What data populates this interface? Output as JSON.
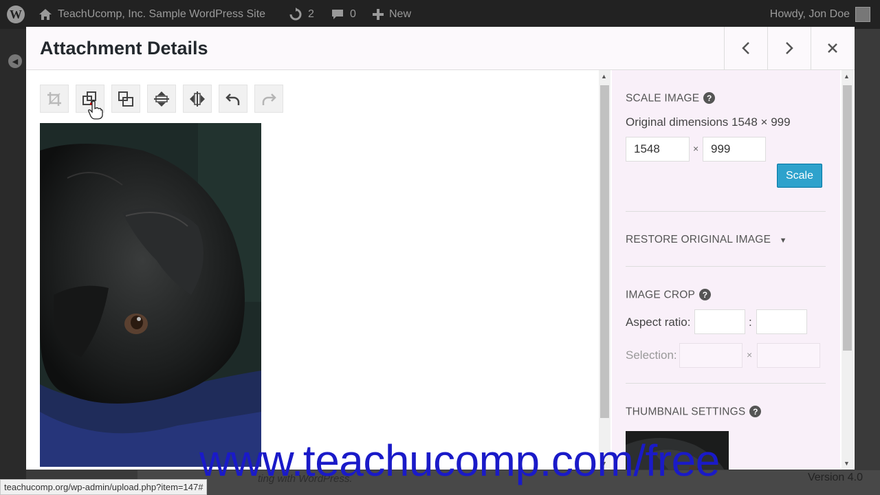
{
  "adminbar": {
    "site_name": "TeachUcomp, Inc. Sample WordPress Site",
    "updates_count": "2",
    "comments_count": "0",
    "new_label": "New",
    "howdy": "Howdy, Jon Doe"
  },
  "modal": {
    "title": "Attachment Details"
  },
  "editor": {
    "tools": [
      {
        "name": "crop",
        "enabled": false
      },
      {
        "name": "rotate-left",
        "enabled": true
      },
      {
        "name": "rotate-right",
        "enabled": true
      },
      {
        "name": "flip-vertical",
        "enabled": true
      },
      {
        "name": "flip-horizontal",
        "enabled": true
      },
      {
        "name": "undo",
        "enabled": true
      },
      {
        "name": "redo",
        "enabled": false
      }
    ]
  },
  "sidebar": {
    "scale": {
      "title": "SCALE IMAGE",
      "original_dimensions": "Original dimensions 1548 × 999",
      "width": "1548",
      "times": "×",
      "height": "999",
      "button": "Scale"
    },
    "restore": {
      "title": "RESTORE ORIGINAL IMAGE"
    },
    "crop": {
      "title": "IMAGE CROP",
      "aspect_label": "Aspect ratio:",
      "aspect_sep": ":",
      "selection_label": "Selection:",
      "selection_sep": "×"
    },
    "thumbnail": {
      "title": "THUMBNAIL SETTINGS"
    },
    "help_glyph": "?"
  },
  "background": {
    "footer_text": "ting with WordPress.",
    "version": "Version 4.0"
  },
  "status_url": "teachucomp.org/wp-admin/upload.php?item=147#",
  "watermark": "www.teachucomp.com/free",
  "colors": {
    "accent": "#2ea2cc",
    "watermark": "#1a1ac8"
  }
}
